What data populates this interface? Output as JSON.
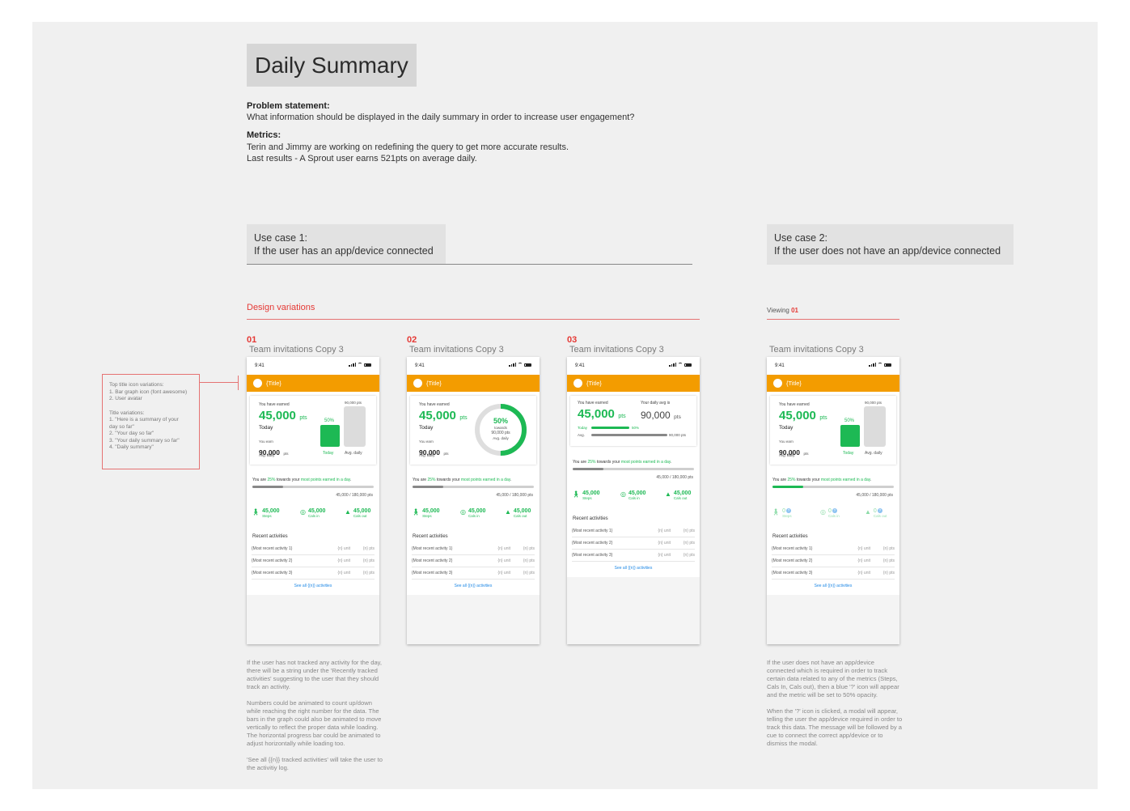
{
  "header": {
    "title": "Daily Summary",
    "problem_label": "Problem statement:",
    "problem_text": "What information should be displayed in the daily summary in order to increase user engagement?",
    "metrics_label": "Metrics:",
    "metrics_line1": "Terin and Jimmy are working on redefining the query to get more accurate results.",
    "metrics_line2": "Last results - A Sprout user earns 521pts on average daily."
  },
  "use_cases": {
    "uc1_line1": "Use case 1:",
    "uc1_line2": "If the user has an app/device connected",
    "uc2_line1": "Use case 2:",
    "uc2_line2": "If the user does not have an app/device connected"
  },
  "labels": {
    "design_variations": "Design variations",
    "viewing_prefix": "Viewing",
    "viewing_num": "01",
    "v1": "01",
    "v2": "02",
    "v3": "03",
    "phone_caption": "Team invitations Copy 3"
  },
  "annotation": {
    "l1": "Top title icon variations:",
    "l2": "1. Bar graph icon (font awesome)",
    "l3": "2. User avatar",
    "l4": "Title variations:",
    "l5": "1. \"Here is a summary of your",
    "l6": "day so far\"",
    "l7": "2. \"Your day so far\"",
    "l8": "3. \"Your daily summary so far\"",
    "l9": "4. \"Daily summary\""
  },
  "phone": {
    "time": "9:41",
    "title": "{Title}",
    "you_have_earned": "You have earned",
    "earned_value": "45,000",
    "pts": "pts",
    "today": "Today",
    "you_earn": "You earn",
    "avg_value": "90,000",
    "avg_daily": "Avg. daily",
    "bar_top_label": "90,000 pts",
    "pct": "50%",
    "today_label": "Today",
    "avg_label": "Avg. daily",
    "towards": "towards",
    "your_daily_avg": "Your daily avg is",
    "avg_short": "Avg.",
    "progress_pre": "You are ",
    "progress_pct": "25%",
    "progress_mid": " towards your ",
    "progress_bold": "most points earned in a day",
    "progress_post": ".",
    "progress_value": "45,000 / 180,000 pts",
    "progress_fraction": 0.25,
    "today_fraction": 0.5,
    "steps_value": "45,000",
    "steps_label": "Steps",
    "calsin_value": "45,000",
    "calsin_label": "Cals in",
    "calsout_value": "45,000",
    "calsout_label": "Cals out",
    "zero_value": "0",
    "q_mark": "?",
    "recent_title": "Recent activities",
    "act1": "{Most recent activity 1}",
    "act2": "{Most recent activity 2}",
    "act3": "{Most recent activity 3}",
    "unit": "{n} unit",
    "npts": "{n} pts",
    "see_all": "See all {{n}} activities"
  },
  "notes": {
    "left_p1": "If the user has not tracked any activity for the day, there will be a string under the 'Recently tracked activities' suggesting to the user that they should track an activity.",
    "left_p2": "Numbers could be animated to count up/down while reaching the right number for the data. The bars in the graph could also be animated to move vertically to reflect the proper data while loading. The horizontal progress bar could be animated to adjust horizontally while loading too.",
    "left_p3": "'See all {{n}} tracked activities' will take the user to the activitiy log.",
    "right_p1": "If the user does not have an app/device connected which is required in order to track certain data related to any of the metrics (Steps, Cals In, Cals out), then a blue '?' icon will appear and the metric will be set to 50% opacity.",
    "right_p2": "When the '?' icon is clicked, a modal will appear, telling the user the app/device required in order to track this data. The message will be followed by a cue to connect the correct app/device or to dismiss the modal."
  },
  "colors": {
    "accent_orange": "#f39c00",
    "green": "#1db954",
    "red": "#e53935",
    "blue": "#1e88e5"
  },
  "icons": [
    "walk-icon",
    "food-icon",
    "fire-icon",
    "question-icon",
    "signal-icon",
    "wifi-icon",
    "battery-icon"
  ]
}
